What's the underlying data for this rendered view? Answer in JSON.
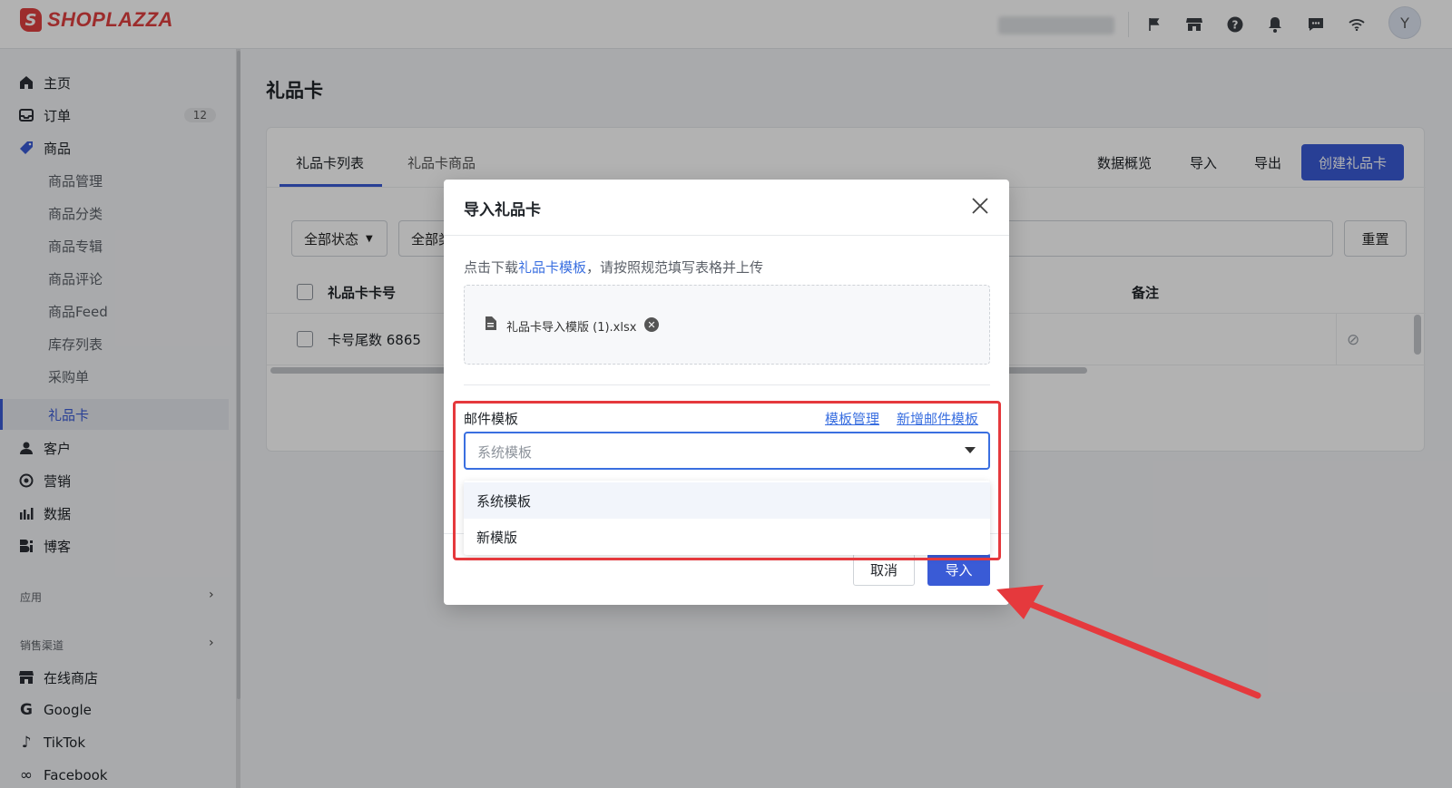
{
  "topbar": {
    "logo_text": "SHOPLAZZA",
    "logo_mark": "S",
    "avatar_letter": "Y",
    "icons": [
      "flag-icon",
      "store-icon",
      "help-icon",
      "bell-icon",
      "chat-icon",
      "wifi-icon"
    ]
  },
  "sidebar": {
    "home": "主页",
    "orders": "订单",
    "orders_badge": "12",
    "products": "商品",
    "product_subs": [
      "商品管理",
      "商品分类",
      "商品专辑",
      "商品评论",
      "商品Feed",
      "库存列表",
      "采购单",
      "礼品卡"
    ],
    "customers": "客户",
    "marketing": "营销",
    "data": "数据",
    "blog": "博客",
    "apps_section": "应用",
    "channels_section": "销售渠道",
    "online_store": "在线商店",
    "google": "Google",
    "tiktok": "TikTok",
    "facebook": "Facebook"
  },
  "page": {
    "title": "礼品卡",
    "tabs": [
      "礼品卡列表",
      "礼品卡商品"
    ],
    "header_links": [
      "数据概览",
      "导入",
      "导出"
    ],
    "create_button": "创建礼品卡",
    "filter_status": "全部状态",
    "filter_second": "全部类",
    "reset_button": "重置",
    "table_header_number": "礼品卡卡号",
    "table_header_note": "备注",
    "row_number": "卡号尾数 6865"
  },
  "modal": {
    "title": "导入礼品卡",
    "hint_prefix": "点击下载",
    "hint_link": "礼品卡模板",
    "hint_suffix": "，请按照规范填写表格并上传",
    "file_name": "礼品卡导入模版 (1).xlsx",
    "email_template_label": "邮件模板",
    "template_manage_link": "模板管理",
    "new_template_link": "新增邮件模板",
    "select_placeholder": "系统模板",
    "options": [
      "系统模板",
      "新模版"
    ],
    "cancel_button": "取消",
    "import_button": "导入"
  },
  "colors": {
    "primary": "#3a5bd6",
    "link": "#3a6fe0",
    "annotation_red": "#e5393d",
    "brand": "#e0403f"
  }
}
